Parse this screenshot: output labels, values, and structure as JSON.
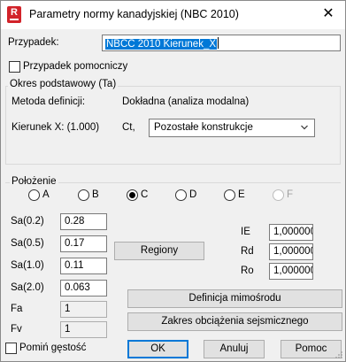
{
  "window": {
    "title": "Parametry normy kanadyjskiej (NBC 2010)",
    "close_glyph": "✕",
    "app_icon_letter": "R"
  },
  "case": {
    "label": "Przypadek:",
    "value": "NBCC 2010 Kierunek_X",
    "auxiliary_label": "Przypadek pomocniczy",
    "auxiliary_checked": false
  },
  "period": {
    "group_label": "Okres podstawowy (Ta)",
    "method_label": "Metoda definicji:",
    "method_value": "Dokładna (analiza modalna)",
    "direction_label": "Kierunek X: (1.000)",
    "ct_label": "Ct,",
    "ct_selected": "Pozostałe konstrukcje"
  },
  "position": {
    "group_label": "Położenie",
    "options": [
      {
        "label": "A",
        "checked": false,
        "enabled": true
      },
      {
        "label": "B",
        "checked": false,
        "enabled": true
      },
      {
        "label": "C",
        "checked": true,
        "enabled": true
      },
      {
        "label": "D",
        "checked": false,
        "enabled": true
      },
      {
        "label": "E",
        "checked": false,
        "enabled": true
      },
      {
        "label": "F",
        "checked": false,
        "enabled": false
      }
    ]
  },
  "params": {
    "sa02_label": "Sa(0.2)",
    "sa02_value": "0.28",
    "sa05_label": "Sa(0.5)",
    "sa05_value": "0.17",
    "sa10_label": "Sa(1.0)",
    "sa10_value": "0.11",
    "sa20_label": "Sa(2.0)",
    "sa20_value": "0.063",
    "fa_label": "Fa",
    "fa_value": "1",
    "fv_label": "Fv",
    "fv_value": "1"
  },
  "coefficients": {
    "ie_label": "IE",
    "ie_value": "1,000000",
    "rd_label": "Rd",
    "rd_value": "1,000000",
    "ro_label": "Ro",
    "ro_value": "1,000000"
  },
  "buttons": {
    "regions": "Regiony",
    "eccentricity": "Definicja mimośrodu",
    "seismic_range": "Zakres obciążenia sejsmicznego",
    "ok": "OK",
    "cancel": "Anuluj",
    "help": "Pomoc"
  },
  "skip_density": {
    "label": "Pomiń gęstość",
    "checked": false
  },
  "colors": {
    "accent": "#0078d7",
    "icon_red": "#d2232a",
    "dialog_bg": "#f0f0f0"
  }
}
